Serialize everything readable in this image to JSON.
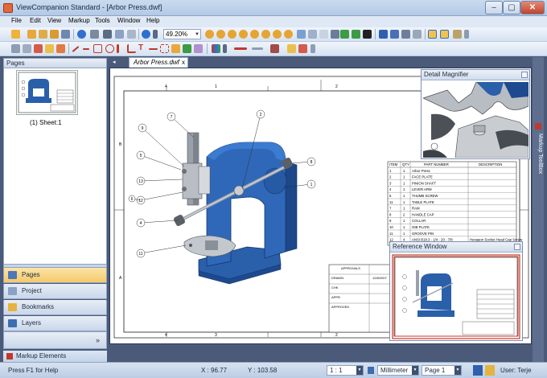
{
  "window": {
    "title": "ViewCompanion Standard - [Arbor Press.dwf]",
    "buttons": {
      "minimize": "–",
      "restore": "▢",
      "close": "✕"
    }
  },
  "menu": [
    "File",
    "Edit",
    "View",
    "Markup",
    "Tools",
    "Window",
    "Help"
  ],
  "toolbar": {
    "zoom_value": "49.20%"
  },
  "left_panel": {
    "pages_header": "Pages",
    "thumbnail_label": "(1) Sheet:1",
    "nav": [
      "Pages",
      "Project",
      "Bookmarks",
      "Layers"
    ],
    "more_glyph": "»",
    "markup_elements": "Markup Elements"
  },
  "document": {
    "tab_label": "Arbor Press.dwf",
    "tab_close": "x",
    "tab_arrow": "◂",
    "frame_numbers_top": [
      "4",
      "1",
      "2",
      "1"
    ],
    "frame_numbers_bottom": [
      "4",
      "3",
      "2",
      "1"
    ],
    "frame_letters": [
      "B",
      "A"
    ],
    "balloons": [
      "7",
      "2",
      "9",
      "5",
      "13",
      "12",
      "6",
      "4",
      "11",
      "1",
      "8"
    ],
    "bom_headers": [
      "ITEM",
      "QTY",
      "PART NUMBER",
      "DESCRIPTION"
    ],
    "bom_rows": [
      [
        "1",
        "1",
        "Arbor Press",
        ""
      ],
      [
        "2",
        "1",
        "FACE PLATE",
        ""
      ],
      [
        "3",
        "1",
        "PINION SHAFT",
        ""
      ],
      [
        "4",
        "1",
        "LEVER ARM",
        ""
      ],
      [
        "5",
        "1",
        "THUMB SCREW",
        ""
      ],
      [
        "11",
        "1",
        "TABLE PLATE",
        ""
      ],
      [
        "7",
        "1",
        "RAM",
        ""
      ],
      [
        "8",
        "2",
        "HANDLE CAP",
        ""
      ],
      [
        "9",
        "1",
        "COLLAR",
        ""
      ],
      [
        "10",
        "1",
        "GIB PLATE",
        ""
      ],
      [
        "11",
        "1",
        "GROOVE PIN",
        ""
      ],
      [
        "12",
        "4",
        "ANSI B18.3 - 1/4 - 20 - 7/8",
        "Hexagon Socket Head Cap Screw"
      ]
    ],
    "title_block": [
      "APPROVALS",
      "DRAWN",
      "CHK",
      "APPR",
      "APPROVED"
    ],
    "title_block_date": "12/8/2007"
  },
  "detail_magnifier": {
    "title": "Detail Magnifier"
  },
  "reference_window": {
    "title": "Reference Window"
  },
  "toolbox": {
    "label": "Markup ToolBox"
  },
  "status": {
    "help": "Press F1 for Help",
    "x": "X : 96.77",
    "y": "Y : 103.58",
    "scale": "1 : 1",
    "units": "Millimeter",
    "page": "Page 1",
    "user": "User: Terje"
  },
  "colors": {
    "part_blue": "#2a5faa",
    "accent": "#f5c96a",
    "markup_red": "#c0392b"
  }
}
